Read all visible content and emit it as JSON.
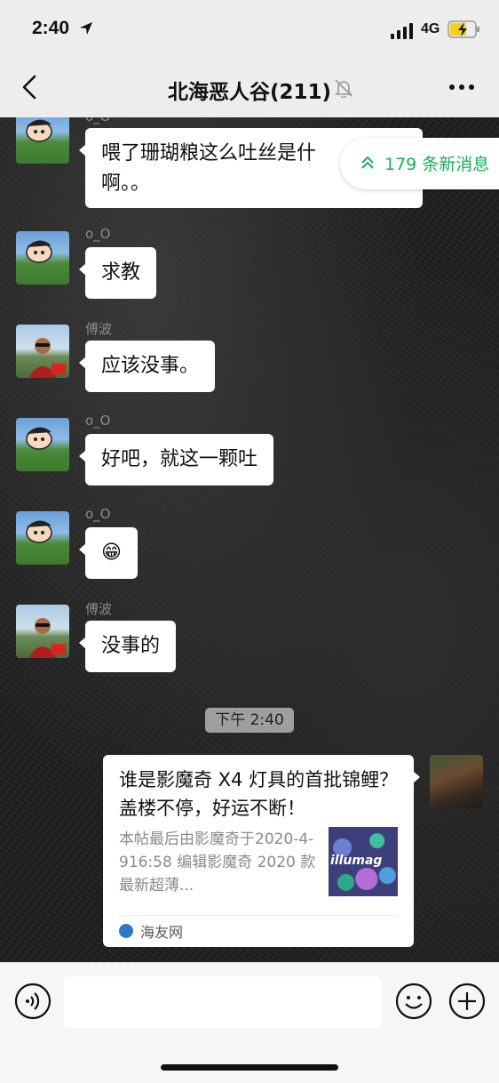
{
  "status": {
    "time": "2:40",
    "network": "4G"
  },
  "header": {
    "title": "北海恶人谷(211)"
  },
  "new_messages_banner": "179 条新消息",
  "messages": [
    {
      "sender": "o_O",
      "text": "喂了珊瑚粮这么吐丝是什\n啊。。"
    },
    {
      "sender": "o_O",
      "text": "求教"
    },
    {
      "sender": "傅波",
      "text": "应该没事。"
    },
    {
      "sender": "o_O",
      "text": "好吧，就这一颗吐"
    },
    {
      "sender": "o_O",
      "text": "😁"
    },
    {
      "sender": "傅波",
      "text": "没事的"
    }
  ],
  "timestamp": "下午 2:40",
  "shared_card": {
    "title": "谁是影魔奇 X4 灯具的首批锦鲤？盖楼不停，好运不断！",
    "description": "本帖最后由影魔奇于2020-4-916:58 编辑影魔奇 2020 款最新超薄...",
    "thumb_text": "illumag",
    "source": "海友网"
  },
  "input": {
    "value": ""
  },
  "colors": {
    "accent_green": "#1aad5a",
    "background_dark": "#1f1f1f"
  }
}
